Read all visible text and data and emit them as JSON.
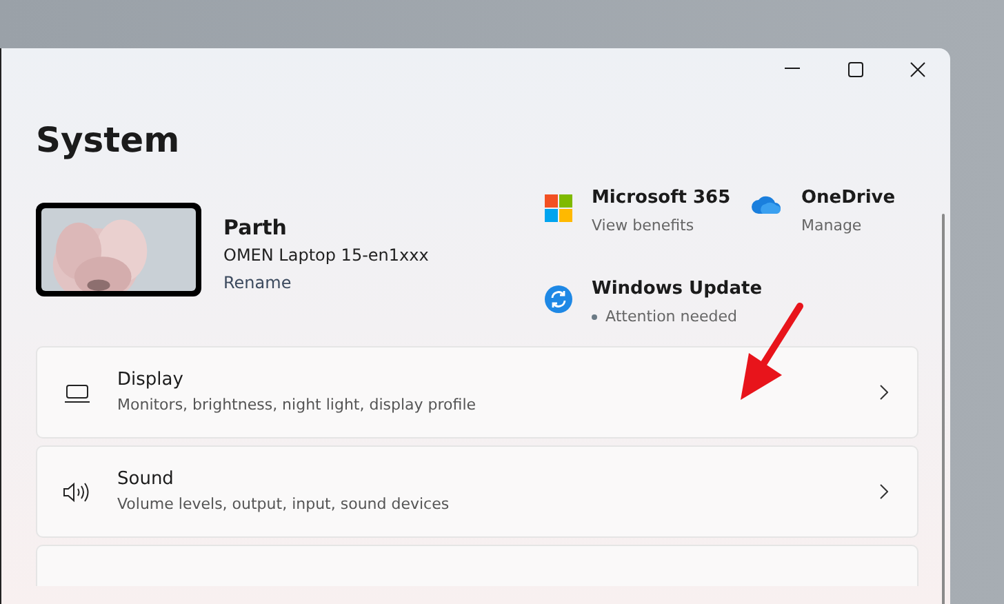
{
  "window": {
    "title": "System"
  },
  "profile": {
    "name": "Parth",
    "device": "OMEN Laptop 15-en1xxx",
    "action": "Rename"
  },
  "tiles": [
    {
      "kind": "microsoft365",
      "title": "Microsoft 365",
      "subtitle": "View benefits"
    },
    {
      "kind": "onedrive",
      "title": "OneDrive",
      "subtitle": "Manage"
    },
    {
      "kind": "update",
      "title": "Windows Update",
      "subtitle": "Attention needed",
      "alert": true
    }
  ],
  "settings": [
    {
      "kind": "display",
      "title": "Display",
      "description": "Monitors, brightness, night light, display profile"
    },
    {
      "kind": "sound",
      "title": "Sound",
      "description": "Volume levels, output, input, sound devices"
    }
  ]
}
